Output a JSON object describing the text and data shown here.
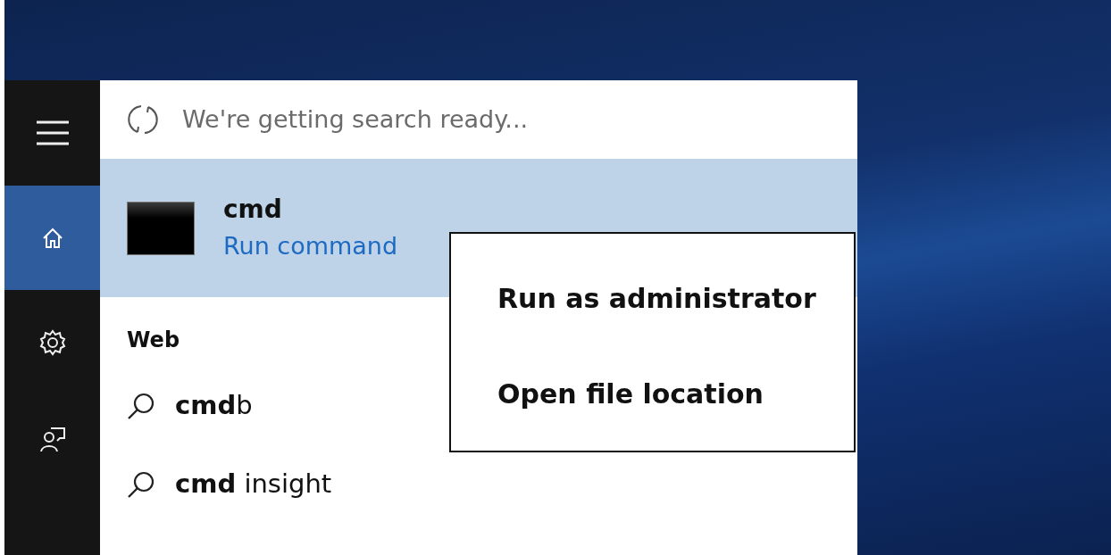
{
  "sidebar": {
    "items": [
      {
        "kind": "menu",
        "selected": false
      },
      {
        "kind": "home",
        "selected": true
      },
      {
        "kind": "settings",
        "selected": false
      },
      {
        "kind": "feedback",
        "selected": false
      }
    ]
  },
  "search": {
    "placeholder": "We're getting search ready..."
  },
  "best_match": {
    "title": "cmd",
    "subtitle": "Run command",
    "selected": true
  },
  "web": {
    "heading": "Web",
    "items": [
      "**cmd**b",
      "**cmd** insight"
    ]
  },
  "context_menu": {
    "items": [
      "Run as administrator",
      "Open file location"
    ]
  }
}
